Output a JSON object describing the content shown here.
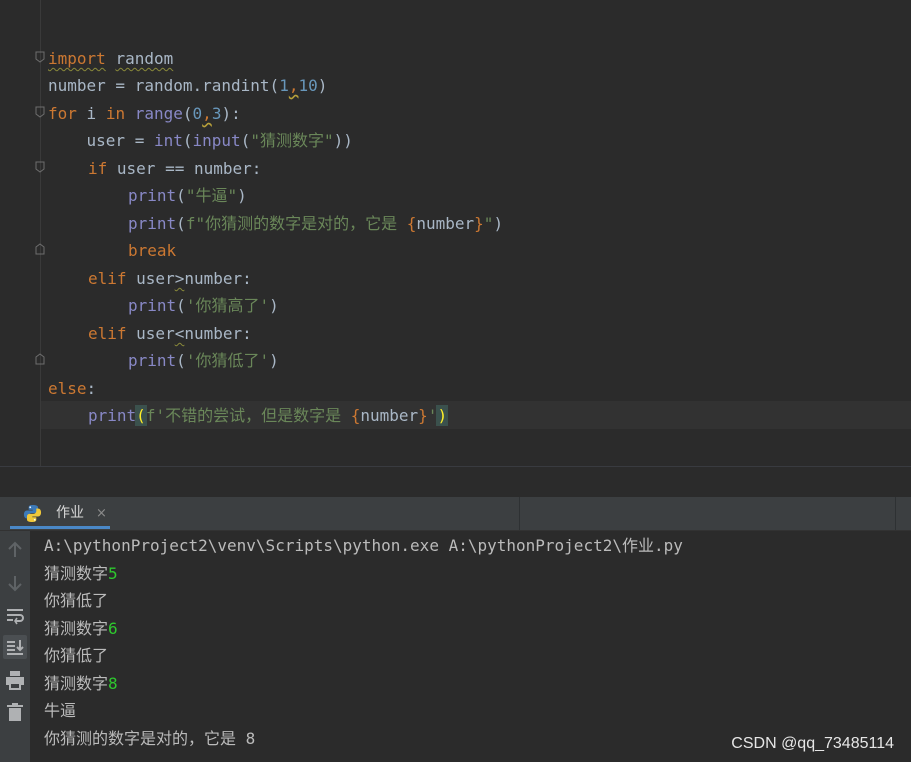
{
  "editor": {
    "code": {
      "l1_import": "import",
      "l1_module": "random",
      "l2_a": "number = random.randint(",
      "l2_n1": "1",
      "l2_comma": ",",
      "l2_n2": "10",
      "l2_b": ")",
      "l3_for": "for",
      "l3_a": " i ",
      "l3_in": "in",
      "l3_range": "range",
      "l3_b": "(",
      "l3_n1": "0",
      "l3_comma": ",",
      "l3_n2": "3",
      "l3_c": "):",
      "l4_a": "    user = ",
      "l4_int": "int",
      "l4_b": "(",
      "l4_input": "input",
      "l4_c": "(",
      "l4_str": "\"猜测数字\"",
      "l4_d": "))",
      "l5_if": "if",
      "l5_a": " user == number:",
      "l6_print": "print",
      "l6_a": "(",
      "l6_str": "\"牛逼\"",
      "l6_b": ")",
      "l7_print": "print",
      "l7_a": "(",
      "l7_str": "f\"你猜测的数字是对的，它是 ",
      "l7_open": "{",
      "l7_var": "number",
      "l7_close": "}",
      "l7_end": "\"",
      "l7_b": ")",
      "l8_break": "break",
      "l9_elif": "elif",
      "l9_a": " user",
      "l9_op": ">",
      "l9_b": "number:",
      "l10_print": "print",
      "l10_a": "(",
      "l10_str": "'你猜高了'",
      "l10_b": ")",
      "l11_elif": "elif",
      "l11_a": " user",
      "l11_op": "<",
      "l11_b": "number:",
      "l12_print": "print",
      "l12_a": "(",
      "l12_str": "'你猜低了'",
      "l12_b": ")",
      "l13_else": "else",
      "l13_a": ":",
      "l14_print": "print",
      "l14_paren": "(",
      "l14_str": "f'不错的尝试，但是数字是 ",
      "l14_open": "{",
      "l14_var": "number",
      "l14_close": "}",
      "l14_end": "'",
      "l14_paren2": ")"
    }
  },
  "run_panel": {
    "tab_label": "作业",
    "tab_close": "×",
    "tab_icon": "python-icon",
    "output": {
      "cmd": "A:\\pythonProject2\\venv\\Scripts\\python.exe A:\\pythonProject2\\作业.py",
      "p1": "猜测数字",
      "in1": "5",
      "r1": "你猜低了",
      "p2": "猜测数字",
      "in2": "6",
      "r2": "你猜低了",
      "p3": "猜测数字",
      "in3": "8",
      "r3": "牛逼",
      "r4": "你猜测的数字是对的，它是 8"
    },
    "side_icons": [
      "up-arrow-icon",
      "down-arrow-icon",
      "soft-wrap-icon",
      "scroll-to-end-icon",
      "print-icon",
      "trash-icon"
    ]
  },
  "watermark": "CSDN @qq_73485114",
  "colors": {
    "editor_bg": "#2b2b2b",
    "keyword": "#cc7832",
    "builtin": "#8888c6",
    "number": "#6897bb",
    "string": "#6a8759",
    "console_input": "#2ec82e",
    "tab_accent": "#4a88c7"
  }
}
